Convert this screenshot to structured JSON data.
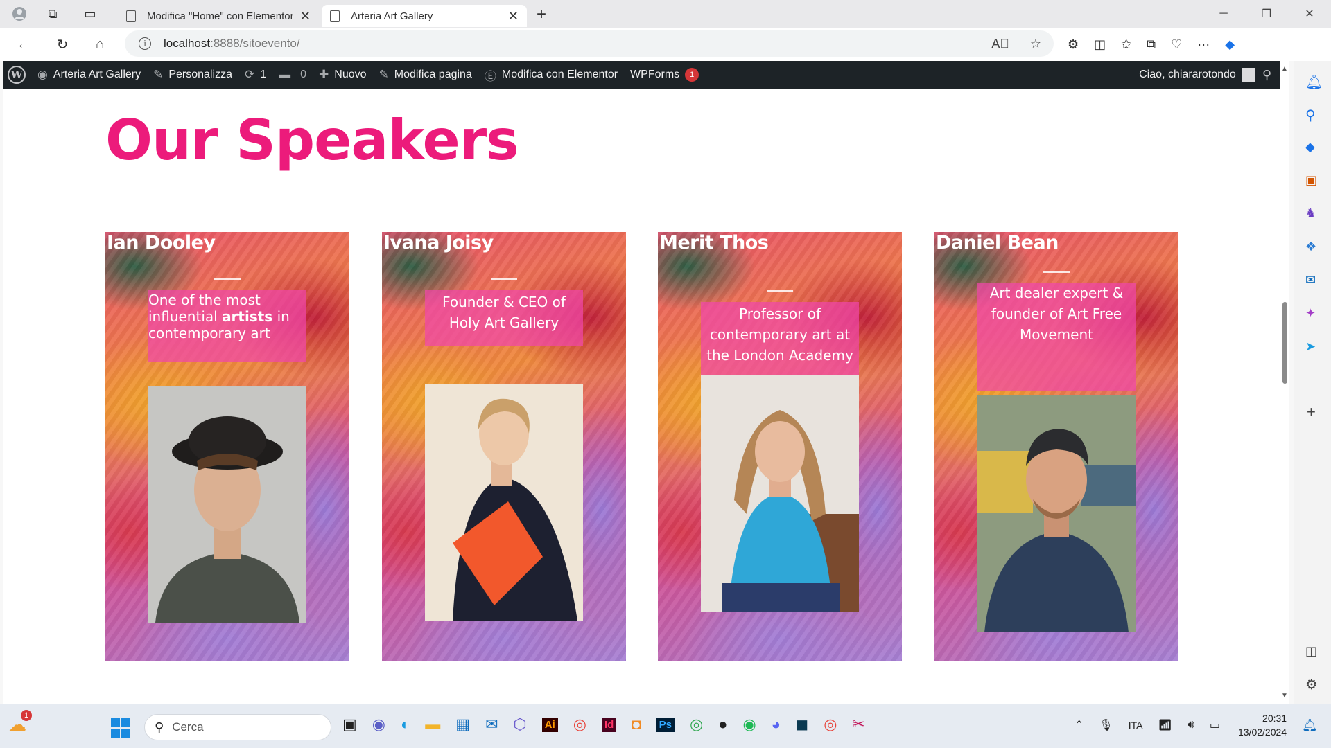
{
  "browser": {
    "tabs": [
      {
        "title": "Modifica \"Home\" con Elementor"
      },
      {
        "title": "Arteria Art Gallery"
      }
    ],
    "url_host": "localhost",
    "url_rest": ":8888/sitoevento/"
  },
  "wpbar": {
    "site_name": "Arteria Art Gallery",
    "customize": "Personalizza",
    "updates_count": "1",
    "comments_count": "0",
    "new": "Nuovo",
    "edit_page": "Modifica pagina",
    "edit_elementor": "Modifica con Elementor",
    "wpforms": "WPForms",
    "wpforms_badge": "1",
    "greeting": "Ciao, chiararotondo"
  },
  "page": {
    "title": "Our Speakers",
    "speakers": [
      {
        "name": "Ian Dooley",
        "desc_parts": [
          "One of the most influential ",
          "artists",
          " in contemporary art"
        ],
        "skin": "#d9b08f",
        "hair": "#3a2a1e",
        "shirt": "#4d524a",
        "bg": "#c9c9c6"
      },
      {
        "name": "Ivana Joisy",
        "desc": "Founder & CEO of Holy Art Gallery",
        "skin": "#edc7a8",
        "hair": "#c9a169",
        "shirt": "#1f2230",
        "bg": "#efe6d8"
      },
      {
        "name": "Merit Thos",
        "desc": "Professor of contemporary art at the London Academy",
        "skin": "#e6b99c",
        "hair": "#a77b4e",
        "shirt": "#2ea6d6",
        "bg": "#e9e5e0"
      },
      {
        "name": "Daniel Bean",
        "desc": "Art dealer expert & founder of Art Free Movement",
        "skin": "#d7a07e",
        "hair": "#2f3033",
        "shirt": "#2c3e5a",
        "bg": "#8b9a7a"
      }
    ]
  },
  "taskbar": {
    "search_placeholder": "Cerca",
    "language": "ITA",
    "time": "20:31",
    "date": "13/02/2024",
    "weather_badge": "1"
  }
}
